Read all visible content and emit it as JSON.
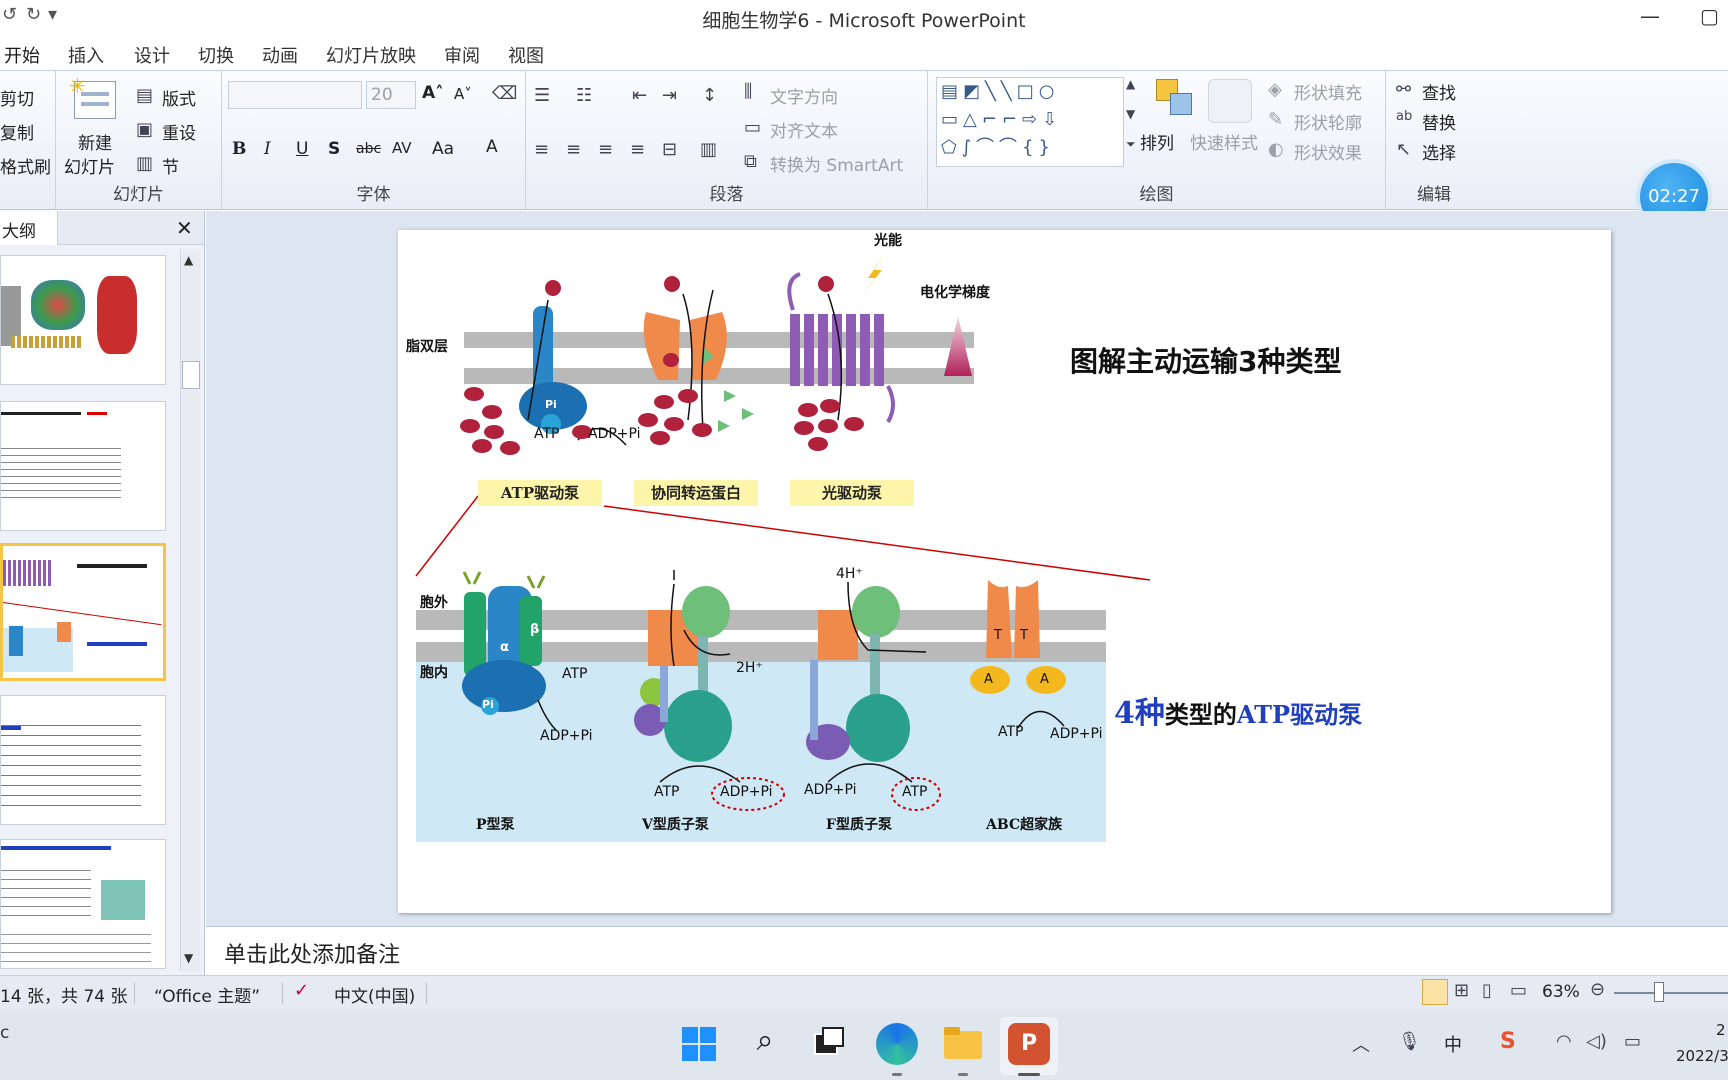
{
  "titlebar": {
    "title": "细胞生物学6 - Microsoft PowerPoint",
    "qat_undo": "↺",
    "qat_more": "▾",
    "minimize": "—",
    "maximize": "▢"
  },
  "tabs": [
    "开始",
    "插入",
    "设计",
    "切换",
    "动画",
    "幻灯片放映",
    "审阅",
    "视图"
  ],
  "ribbon": {
    "clipboard": {
      "cut": "剪切",
      "copy": "复制",
      "format_painter": "格式刷"
    },
    "slides": {
      "new_slide_line1": "新建",
      "new_slide_line2": "幻灯片",
      "layout": "版式",
      "reset": "重设",
      "section": "节",
      "label": "幻灯片"
    },
    "font": {
      "size": "20",
      "bold": "B",
      "italic": "I",
      "underline": "U",
      "shadow": "S",
      "strike": "abc",
      "spacing": "AV",
      "case": "Aa",
      "color": "A",
      "label": "字体"
    },
    "paragraph": {
      "text_direction": "文字方向",
      "align_text": "对齐文本",
      "smartart": "转换为 SmartArt",
      "label": "段落"
    },
    "drawing": {
      "arrange": "排列",
      "quick_styles": "快速样式",
      "shape_fill": "形状填充",
      "shape_outline": "形状轮廓",
      "shape_effects": "形状效果",
      "label": "绘图"
    },
    "editing": {
      "find": "查找",
      "replace": "替换",
      "select": "选择",
      "label": "编辑"
    }
  },
  "timer": "02:27",
  "left_panel": {
    "tab_outline": "大纲",
    "close": "✕"
  },
  "slide": {
    "title": "图解主动运输3种类型",
    "label_lipid_bilayer": "脂双层",
    "label_light_energy": "光能",
    "label_gradient": "电化学梯度",
    "top_pumps": [
      "ATP驱动泵",
      "协同转运蛋白",
      "光驱动泵"
    ],
    "top_atp": "ATP",
    "top_adp": "ADP+Pi",
    "top_pi": "Pi",
    "label_outside": "胞外",
    "label_inside": "胞内",
    "p_pump": {
      "alpha": "α",
      "beta": "β",
      "pi": "Pi",
      "atp": "ATP",
      "adp": "ADP+Pi",
      "name": "P型泵"
    },
    "v_pump": {
      "h": "2H⁺",
      "atp": "ATP",
      "adp": "ADP+Pi",
      "name": "V型质子泵"
    },
    "f_pump": {
      "h": "4H⁺",
      "adp": "ADP+Pi",
      "atp": "ATP",
      "name": "F型质子泵"
    },
    "abc": {
      "t": "T",
      "a": "A",
      "atp": "ATP",
      "adp": "ADP+Pi",
      "name": "ABC超家族"
    },
    "caption_num": "4种",
    "caption_mid": "类型的",
    "caption_end": "ATP驱动泵"
  },
  "notes": {
    "placeholder": "单击此处添加备注"
  },
  "statusbar": {
    "slide_count": "14 张，共 74 张",
    "theme": "“Office 主题”",
    "language": "中文(中国)",
    "zoom": "63%"
  },
  "taskbar": {
    "ime": "中",
    "time_partial": "2",
    "date_partial": "2022/3"
  },
  "colors": {
    "accent_blue": "#1f3fbf",
    "membrane_gray": "#b9b9b9",
    "cytosol_blue": "#cfe8f6",
    "molecule_red": "#b0213c",
    "pump_purple": "#8e5bb5"
  }
}
